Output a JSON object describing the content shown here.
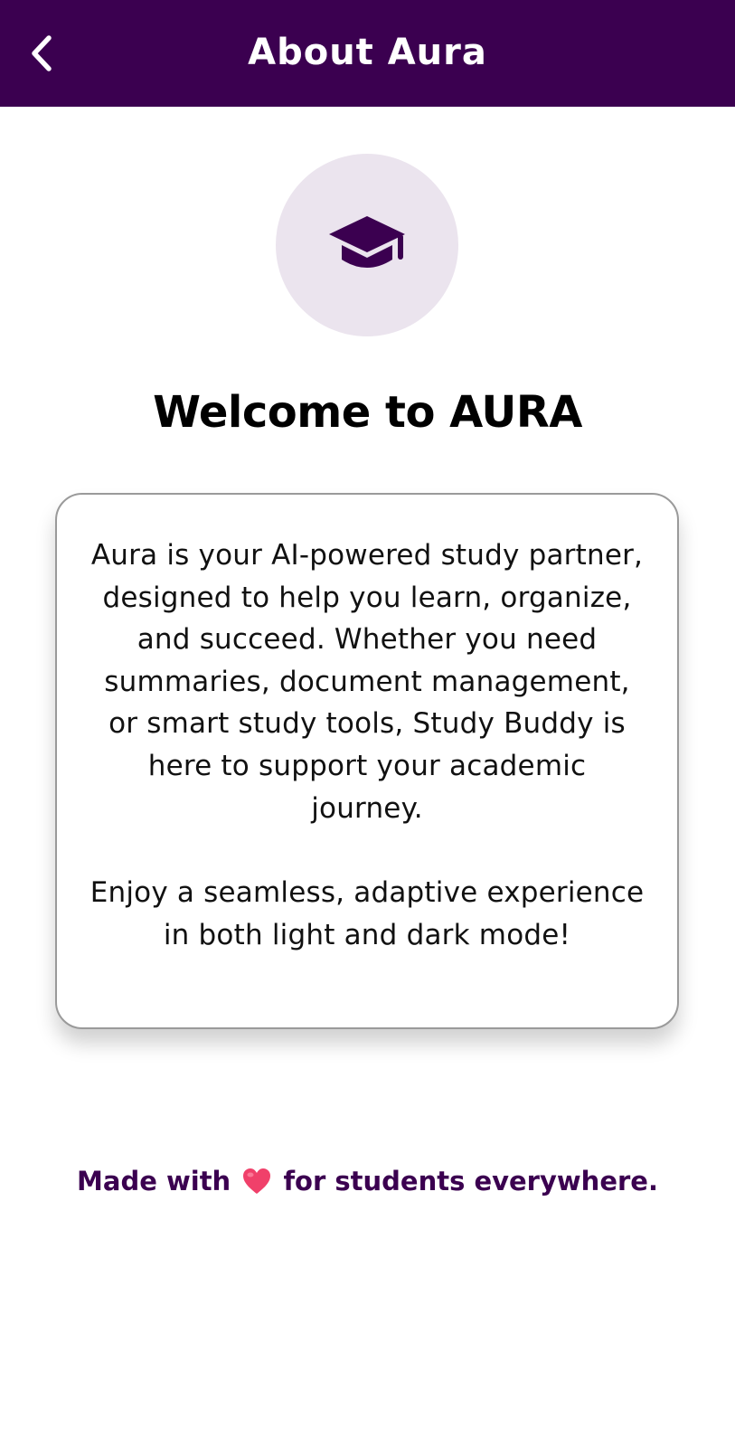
{
  "header": {
    "title": "About Aura",
    "back_icon": "chevron-left-icon",
    "background_color": "#3b0050"
  },
  "avatar": {
    "icon": "graduation-cap-icon",
    "background_color": "#ebe4ee",
    "icon_color": "#3b0050"
  },
  "welcome": {
    "title": "Welcome to AURA"
  },
  "card": {
    "paragraph_1": "Aura is your AI-powered study partner, designed to help you learn, organize, and succeed. Whether you need summaries, document management, or smart study tools, Study Buddy is here to support your academic journey.",
    "paragraph_2": "Enjoy a seamless, adaptive experience in both light and dark mode!"
  },
  "footer": {
    "text_before": "Made with",
    "icon": "heart-icon",
    "text_after": "for students everywhere.",
    "color": "#3b0050",
    "heart_color": "#f0406a"
  }
}
